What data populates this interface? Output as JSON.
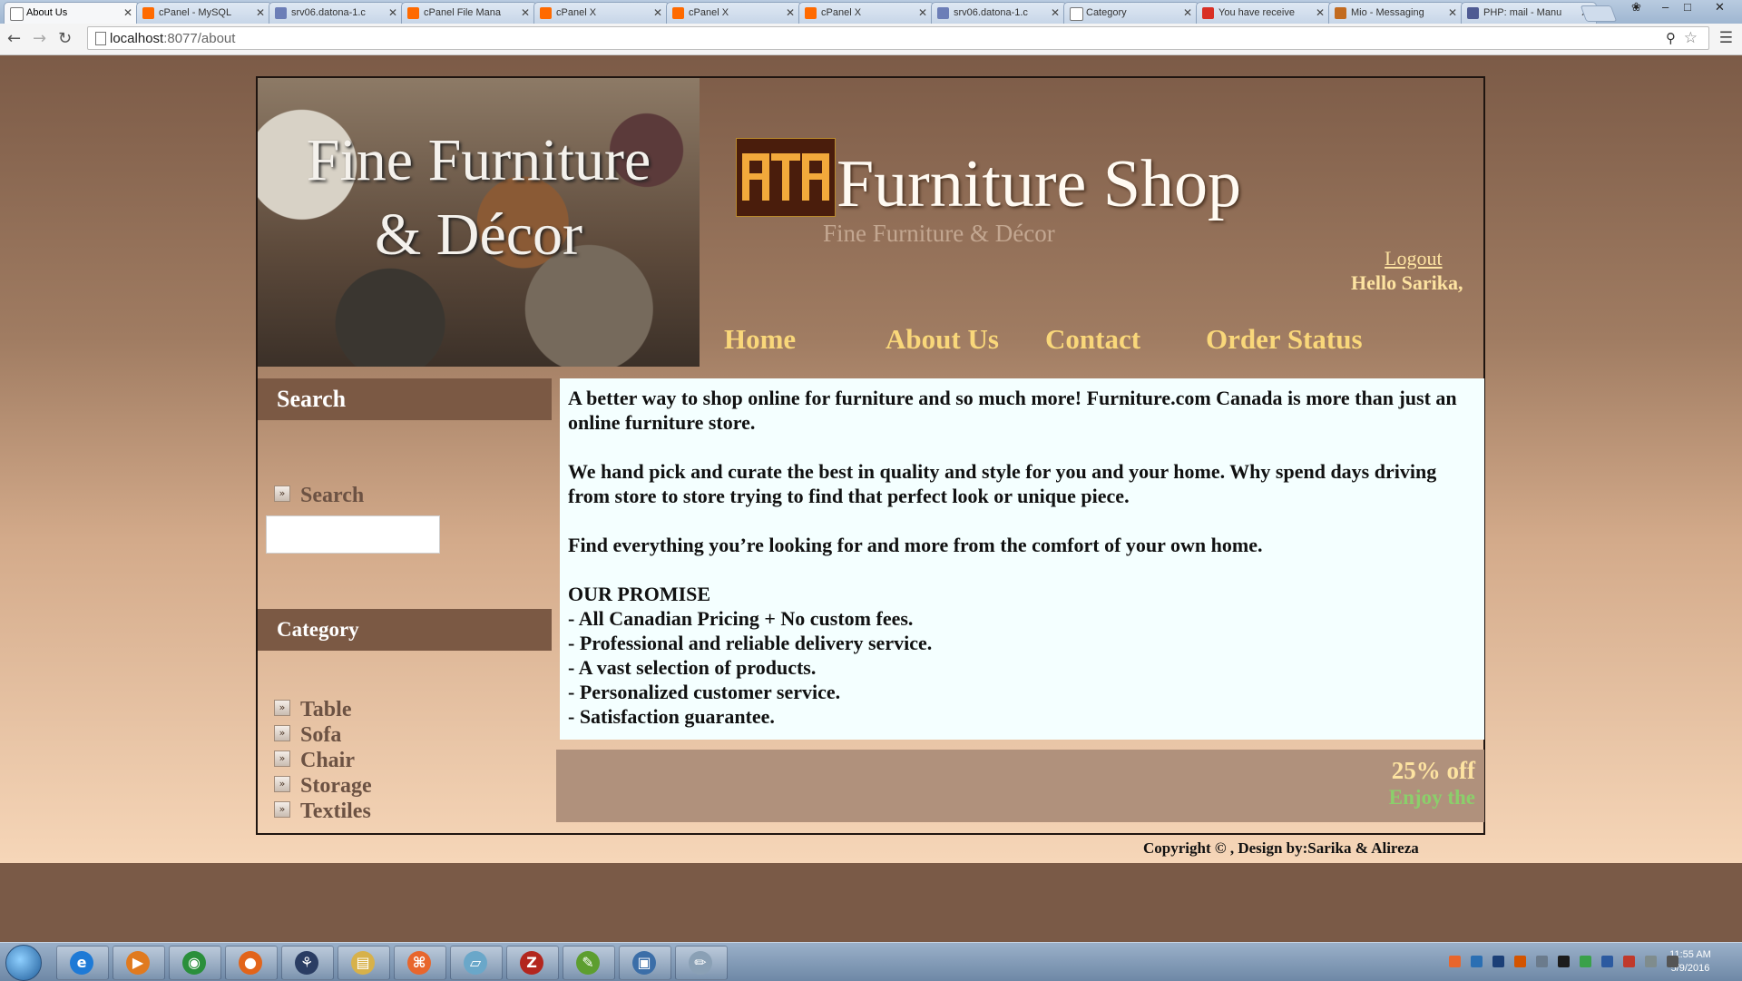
{
  "browser": {
    "tabs": [
      {
        "title": "About Us",
        "icon": "page-icon",
        "color": "#ffffff"
      },
      {
        "title": "cPanel - MySQL",
        "icon": "cpanel-icon",
        "color": "#ff6a00"
      },
      {
        "title": "srv06.datona-1.c",
        "icon": "phpmyadmin-icon",
        "color": "#6c7eb7"
      },
      {
        "title": "cPanel File Mana",
        "icon": "cpanel-icon",
        "color": "#ff6a00"
      },
      {
        "title": "cPanel X",
        "icon": "cpanel-icon",
        "color": "#ff6a00"
      },
      {
        "title": "cPanel X",
        "icon": "cpanel-icon",
        "color": "#ff6a00"
      },
      {
        "title": "cPanel X",
        "icon": "cpanel-icon",
        "color": "#ff6a00"
      },
      {
        "title": "srv06.datona-1.c",
        "icon": "phpmyadmin-icon",
        "color": "#6c7eb7"
      },
      {
        "title": "Category",
        "icon": "page-icon",
        "color": "#ffffff"
      },
      {
        "title": "You have receive",
        "icon": "gmail-icon",
        "color": "#d93025"
      },
      {
        "title": "Mio - Messaging",
        "icon": "mio-icon",
        "color": "#c26b20"
      },
      {
        "title": "PHP: mail - Manu",
        "icon": "php-icon",
        "color": "#4f5b93"
      }
    ],
    "url_host": "localhost",
    "url_path": ":8077/about",
    "window_controls": {
      "user": "❀",
      "minimize": "–",
      "maximize": "□",
      "close": "✕"
    }
  },
  "site": {
    "hero_text_line1": "Fine Furniture",
    "hero_text_line2": "& Décor",
    "shop_title": "Furniture Shop",
    "shop_subtitle": "Fine Furniture & Décor",
    "logout_label": "Logout",
    "greeting": "Hello Sarika,",
    "nav": [
      {
        "label": "Home"
      },
      {
        "label": "About Us"
      },
      {
        "label": "Contact"
      },
      {
        "label": "Order Status"
      }
    ],
    "sidebar": {
      "search_heading": "Search",
      "search_label": "Search",
      "search_value": "",
      "category_heading": "Category",
      "categories": [
        "Table",
        "Sofa",
        "Chair",
        "Storage",
        "Textiles"
      ]
    },
    "content": {
      "para1": "A better way to shop online for furniture and so much more! Furniture.com Canada is more than just an online furniture store.",
      "para2": "We hand pick and curate the best in quality and style for you and your home. Why spend days driving from store to store trying to find that perfect look or unique piece.",
      "para3": "Find everything you’re looking for and more from the comfort of your own home.",
      "promise_heading": "OUR PROMISE",
      "promises": [
        "- All Canadian Pricing + No custom fees.",
        "- Professional and reliable delivery service.",
        "- A vast selection of products.",
        "- Personalized customer service.",
        "- Satisfaction guarantee."
      ]
    },
    "promo": {
      "main": "25% off",
      "sub": "Enjoy the"
    },
    "footer": "Copyright © , Design by:Sarika & Alireza",
    "colors": {
      "nav": "#f9d77a",
      "accent": "#fde3a1",
      "promo_sub": "#8bcf6b",
      "sidebar_head": "#7b5944"
    }
  },
  "taskbar": {
    "apps": [
      {
        "name": "internet-explorer-icon",
        "glyph": "e",
        "color": "#1e7ad6"
      },
      {
        "name": "media-player-icon",
        "glyph": "▶",
        "color": "#e07a1f"
      },
      {
        "name": "chrome-icon",
        "glyph": "◉",
        "color": "#2a8f3b"
      },
      {
        "name": "firefox-icon",
        "glyph": "●",
        "color": "#e2641a"
      },
      {
        "name": "app-tree-icon",
        "glyph": "⚘",
        "color": "#2a3d63"
      },
      {
        "name": "file-explorer-icon",
        "glyph": "▤",
        "color": "#d7b14a"
      },
      {
        "name": "xampp-icon",
        "glyph": "⌘",
        "color": "#e8662c"
      },
      {
        "name": "notepad-icon",
        "glyph": "▱",
        "color": "#6aa7c9"
      },
      {
        "name": "filezilla-icon",
        "glyph": "Z",
        "color": "#b3261e"
      },
      {
        "name": "editor-icon",
        "glyph": "✎",
        "color": "#5d9e2f"
      },
      {
        "name": "virtualbox-icon",
        "glyph": "▣",
        "color": "#3b6ea8"
      },
      {
        "name": "paint-icon",
        "glyph": "✏",
        "color": "#8aa0b5"
      }
    ],
    "clock_time": "11:55 AM",
    "clock_date": "5/9/2016"
  }
}
